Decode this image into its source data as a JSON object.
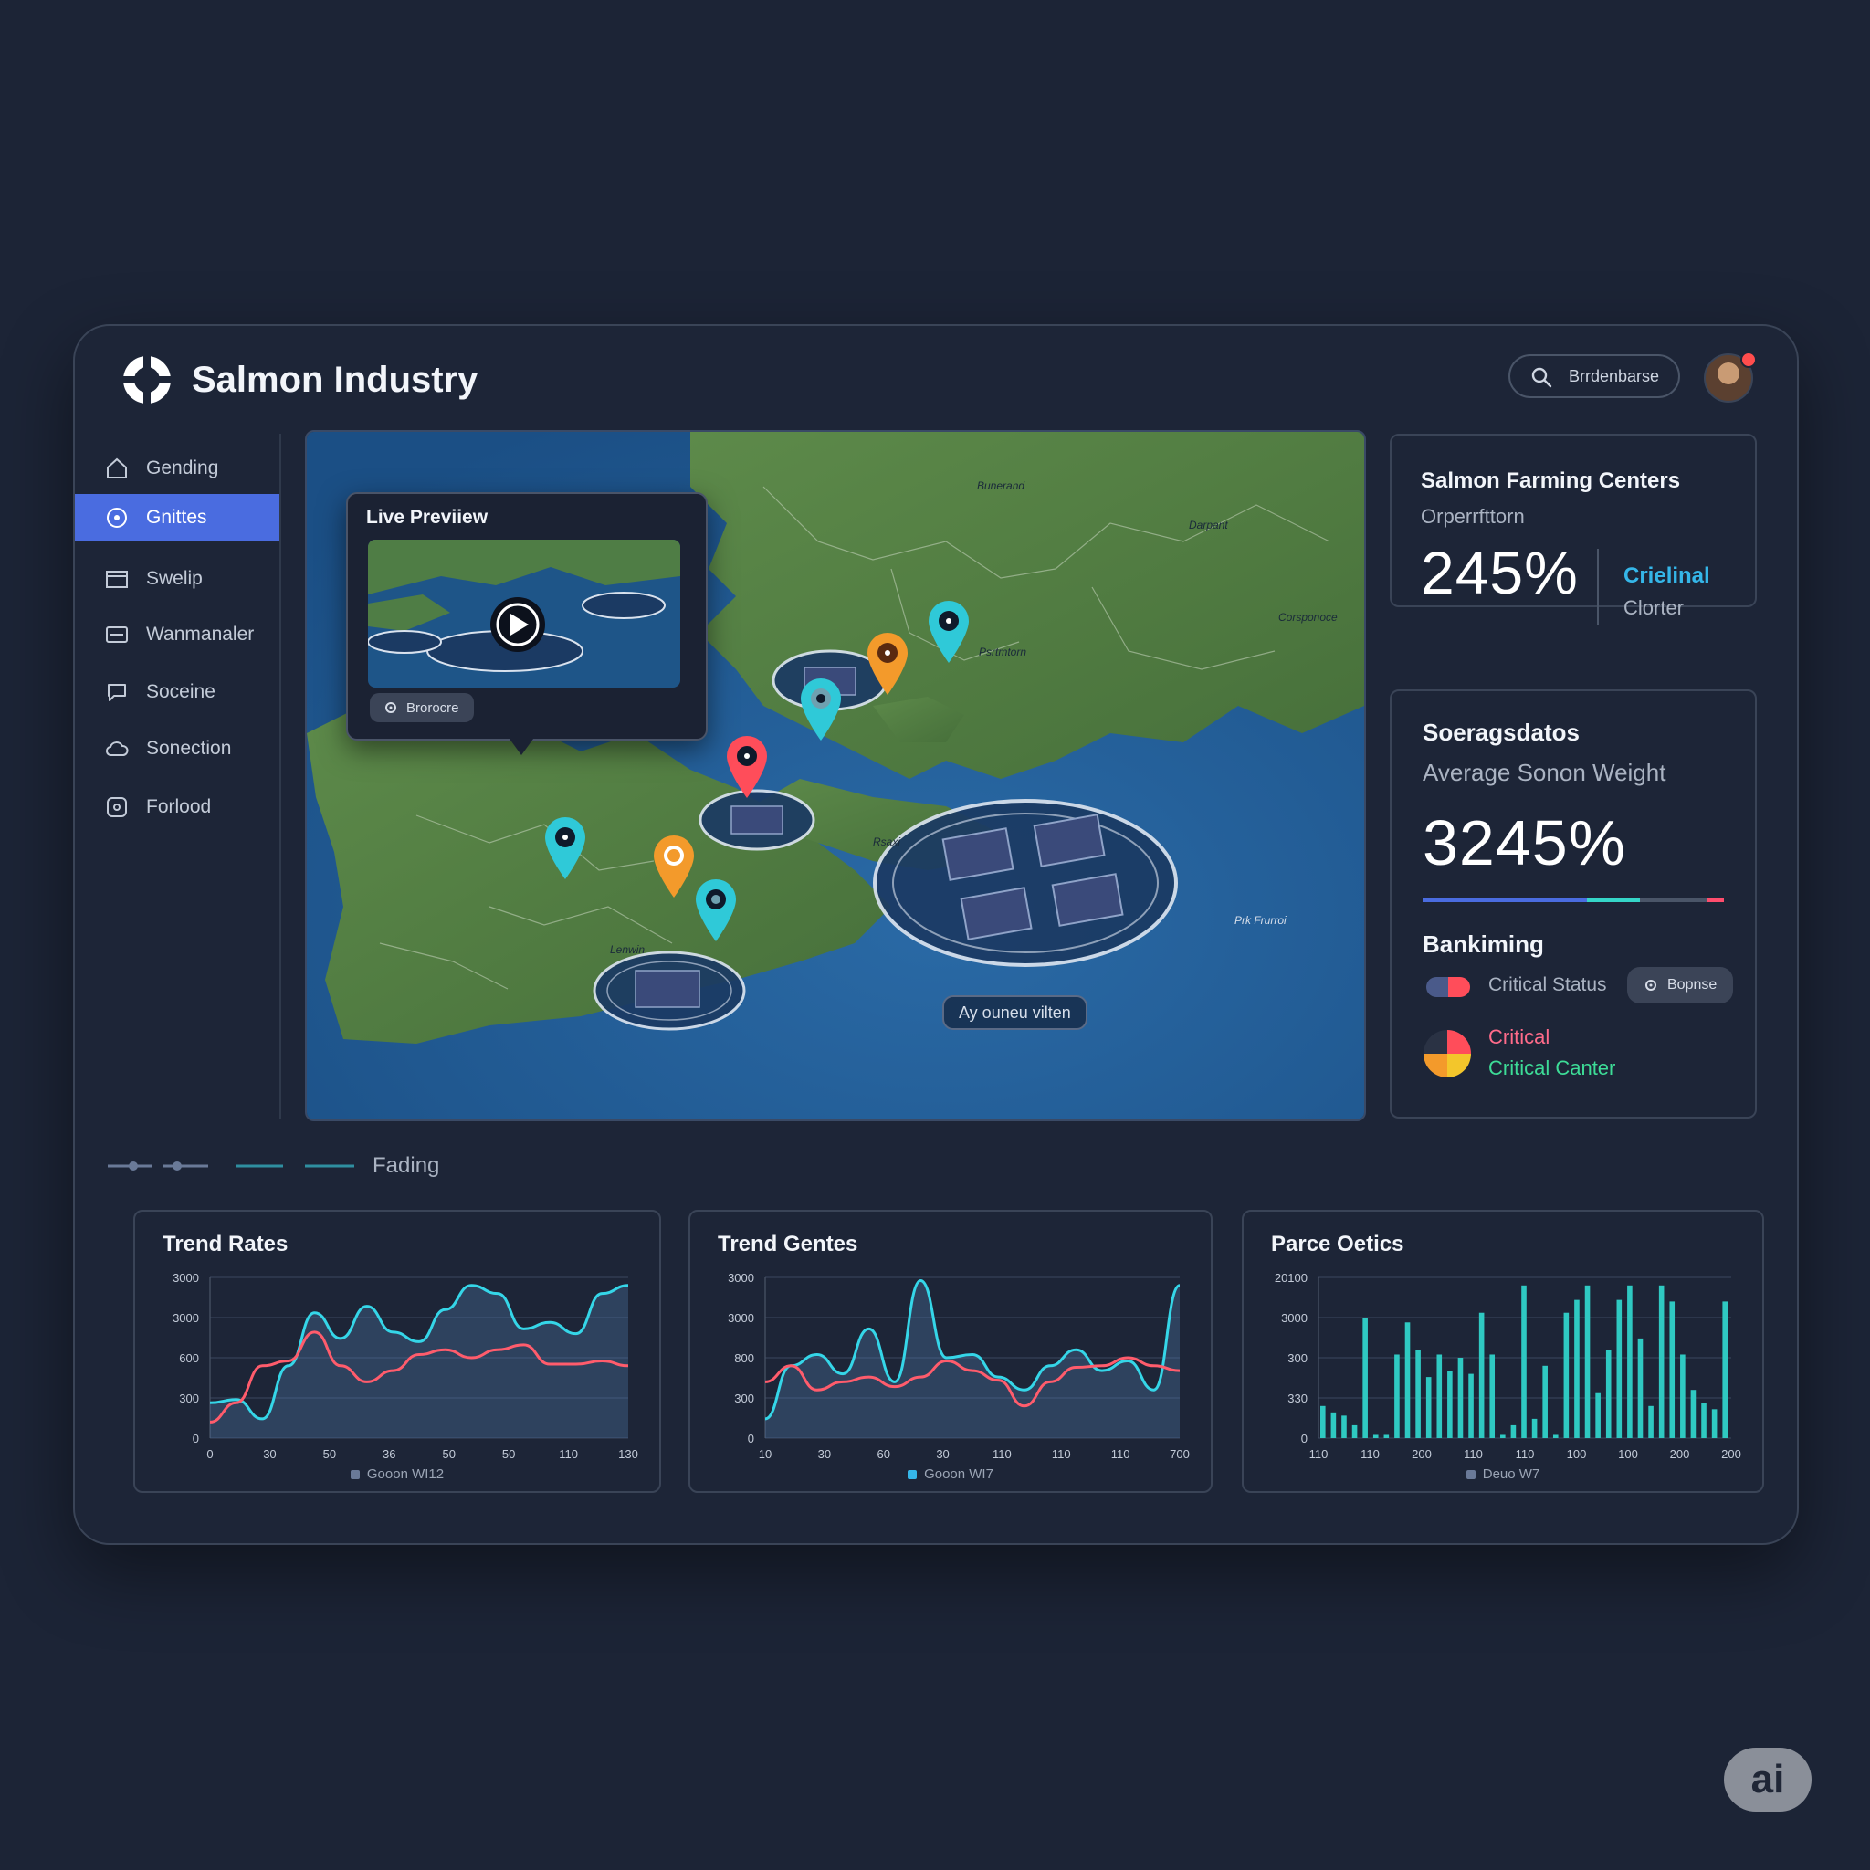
{
  "app": {
    "title": "Salmon Industry",
    "logo_icon": "logo-ring-icon"
  },
  "search": {
    "label": "Brrdenbarse",
    "icon": "search-icon"
  },
  "sidebar": {
    "items": [
      {
        "label": "Gending",
        "icon": "home-icon"
      },
      {
        "label": "Gnittes",
        "icon": "target-icon",
        "active": true
      },
      {
        "label": "Swelip",
        "icon": "folder-icon"
      },
      {
        "label": "Wanmanaler",
        "icon": "card-icon"
      },
      {
        "label": "Soceine",
        "icon": "chat-icon"
      },
      {
        "label": "Sonection",
        "icon": "cloud-icon"
      },
      {
        "label": "Forlood",
        "icon": "box-icon"
      }
    ]
  },
  "map": {
    "preview": {
      "title": "Live Previiew",
      "button": "Brorocre"
    },
    "tag": "Ay ouneu vilten",
    "small_labels": [
      "Bunerand",
      "Darpant",
      "Corsponoce",
      "Psrtmtorn",
      "Lenwin",
      "Rsaxi",
      "Prk Frurroi"
    ]
  },
  "centers_card": {
    "title": "Salmon Farming Centers",
    "subtitle": "Orperrfttorn",
    "value": "245%",
    "side_accent": "Crielinal",
    "side_label": "Clorter"
  },
  "weight_card": {
    "title": "Soeragsdatos",
    "subtitle": "Average Sonon Weight",
    "value": "3245%",
    "bar_colors": [
      "#4a6ce0",
      "#35d6c8",
      "#4a5568",
      "#ff4d6d"
    ],
    "section_title": "Bankiming",
    "status_label": "Critical Status",
    "status_button": "Bopnse",
    "critical_label": "Critical",
    "critical_center": "Critical Canter"
  },
  "legend_row": {
    "label": "Fading"
  },
  "chart_data": [
    {
      "type": "line",
      "title": "Trend Rates",
      "yticks": [
        "3000",
        "3000",
        "600",
        "300",
        "0"
      ],
      "xticks": [
        "0",
        "30",
        "50",
        "36",
        "50",
        "50",
        "110",
        "130"
      ],
      "series": [
        {
          "name": "Gooon WI12",
          "color": "#35d6e8",
          "values": [
            0.22,
            0.24,
            0.12,
            0.45,
            0.78,
            0.62,
            0.82,
            0.66,
            0.6,
            0.8,
            0.95,
            0.9,
            0.68,
            0.72,
            0.65,
            0.9,
            0.95
          ]
        },
        {
          "color": "#ff5c6c",
          "values": [
            0.1,
            0.22,
            0.45,
            0.48,
            0.66,
            0.45,
            0.35,
            0.42,
            0.52,
            0.55,
            0.5,
            0.55,
            0.58,
            0.46,
            0.46,
            0.48,
            0.45
          ]
        }
      ]
    },
    {
      "type": "line",
      "title": "Trend Gentes",
      "yticks": [
        "3000",
        "3000",
        "800",
        "300",
        "0"
      ],
      "xticks": [
        "10",
        "30",
        "60",
        "30",
        "110",
        "110",
        "110",
        "700"
      ],
      "series": [
        {
          "name": "Gooon WI7",
          "color": "#35d6e8",
          "values": [
            0.12,
            0.45,
            0.52,
            0.4,
            0.68,
            0.35,
            0.98,
            0.5,
            0.52,
            0.38,
            0.3,
            0.45,
            0.55,
            0.42,
            0.48,
            0.3,
            0.95
          ]
        },
        {
          "color": "#ff5c6c",
          "values": [
            0.35,
            0.45,
            0.3,
            0.35,
            0.38,
            0.32,
            0.38,
            0.48,
            0.42,
            0.36,
            0.2,
            0.35,
            0.44,
            0.45,
            0.5,
            0.45,
            0.42
          ]
        }
      ]
    },
    {
      "type": "bar",
      "title": "Parce Oetics",
      "yticks": [
        "20100",
        "3000",
        "300",
        "330",
        "0"
      ],
      "xticks": [
        "110",
        "110",
        "200",
        "110",
        "110",
        "100",
        "100",
        "200",
        "200"
      ],
      "series": [
        {
          "name": "Deuo W7",
          "color": "#2fc9c2",
          "values": [
            0.2,
            0.16,
            0.14,
            0.08,
            0.75,
            0.02,
            0.02,
            0.52,
            0.72,
            0.55,
            0.38,
            0.52,
            0.42,
            0.5,
            0.4,
            0.78,
            0.52,
            0.02,
            0.08,
            0.95,
            0.12,
            0.45,
            0.02,
            0.78,
            0.86,
            0.95,
            0.28,
            0.55,
            0.86,
            0.95,
            0.62,
            0.2,
            0.95,
            0.85,
            0.52,
            0.3,
            0.22,
            0.18,
            0.85
          ]
        }
      ]
    }
  ]
}
